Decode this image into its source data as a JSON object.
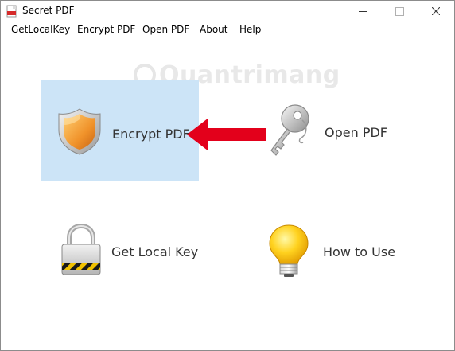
{
  "window": {
    "title": "Secret PDF"
  },
  "menu": {
    "items": [
      "GetLocalKey",
      "Encrypt PDF",
      "Open PDF",
      "About",
      "Help"
    ]
  },
  "tiles": {
    "encrypt": {
      "label": "Encrypt PDF",
      "icon": "shield-icon",
      "selected": true
    },
    "open": {
      "label": "Open PDF",
      "icon": "key-icon"
    },
    "local_key": {
      "label": "Get Local Key",
      "icon": "padlock-icon"
    },
    "how_to": {
      "label": "How to Use",
      "icon": "lightbulb-icon"
    }
  },
  "annotation": {
    "icon": "red-arrow-icon",
    "color": "#e3001b"
  },
  "watermark": {
    "text": "Quantrimang"
  },
  "colors": {
    "selection": "#cce4f7"
  }
}
